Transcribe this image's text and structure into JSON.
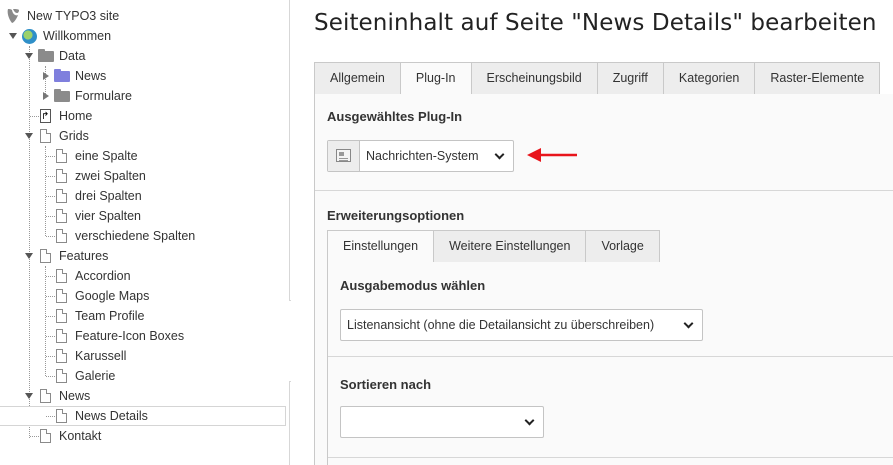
{
  "tree": {
    "items": [
      {
        "label": "New TYPO3 site"
      },
      {
        "label": "Willkommen"
      },
      {
        "label": "Data"
      },
      {
        "label": "News"
      },
      {
        "label": "Formulare"
      },
      {
        "label": "Home"
      },
      {
        "label": "Grids"
      },
      {
        "label": "eine Spalte"
      },
      {
        "label": "zwei Spalten"
      },
      {
        "label": "drei Spalten"
      },
      {
        "label": "vier Spalten"
      },
      {
        "label": "verschiedene Spalten"
      },
      {
        "label": "Features"
      },
      {
        "label": "Accordion"
      },
      {
        "label": "Google Maps"
      },
      {
        "label": "Team Profile"
      },
      {
        "label": "Feature-Icon Boxes"
      },
      {
        "label": "Karussell"
      },
      {
        "label": "Galerie"
      },
      {
        "label": "News"
      },
      {
        "label": "News Details"
      },
      {
        "label": "Kontakt"
      }
    ]
  },
  "header": {
    "title": "Seiteninhalt auf Seite \"News Details\" bearbeiten"
  },
  "main_tabs": [
    {
      "label": "Allgemein"
    },
    {
      "label": "Plug-In"
    },
    {
      "label": "Erscheinungsbild"
    },
    {
      "label": "Zugriff"
    },
    {
      "label": "Kategorien"
    },
    {
      "label": "Raster-Elemente"
    }
  ],
  "plugin": {
    "section_title": "Ausgewähltes Plug-In",
    "selected": "Nachrichten-System"
  },
  "extension": {
    "section_title": "Erweiterungsoptionen",
    "tabs": [
      {
        "label": "Einstellungen"
      },
      {
        "label": "Weitere Einstellungen"
      },
      {
        "label": "Vorlage"
      }
    ],
    "output_mode": {
      "label": "Ausgabemodus wählen",
      "selected": "Listenansicht (ohne die Detailansicht zu überschreiben)"
    },
    "sort_by": {
      "label": "Sortieren nach",
      "selected": ""
    }
  },
  "colors": {
    "annotation_arrow": "#e8141b",
    "tab_inactive": "#ededed",
    "panel_bg": "#fafafa"
  }
}
